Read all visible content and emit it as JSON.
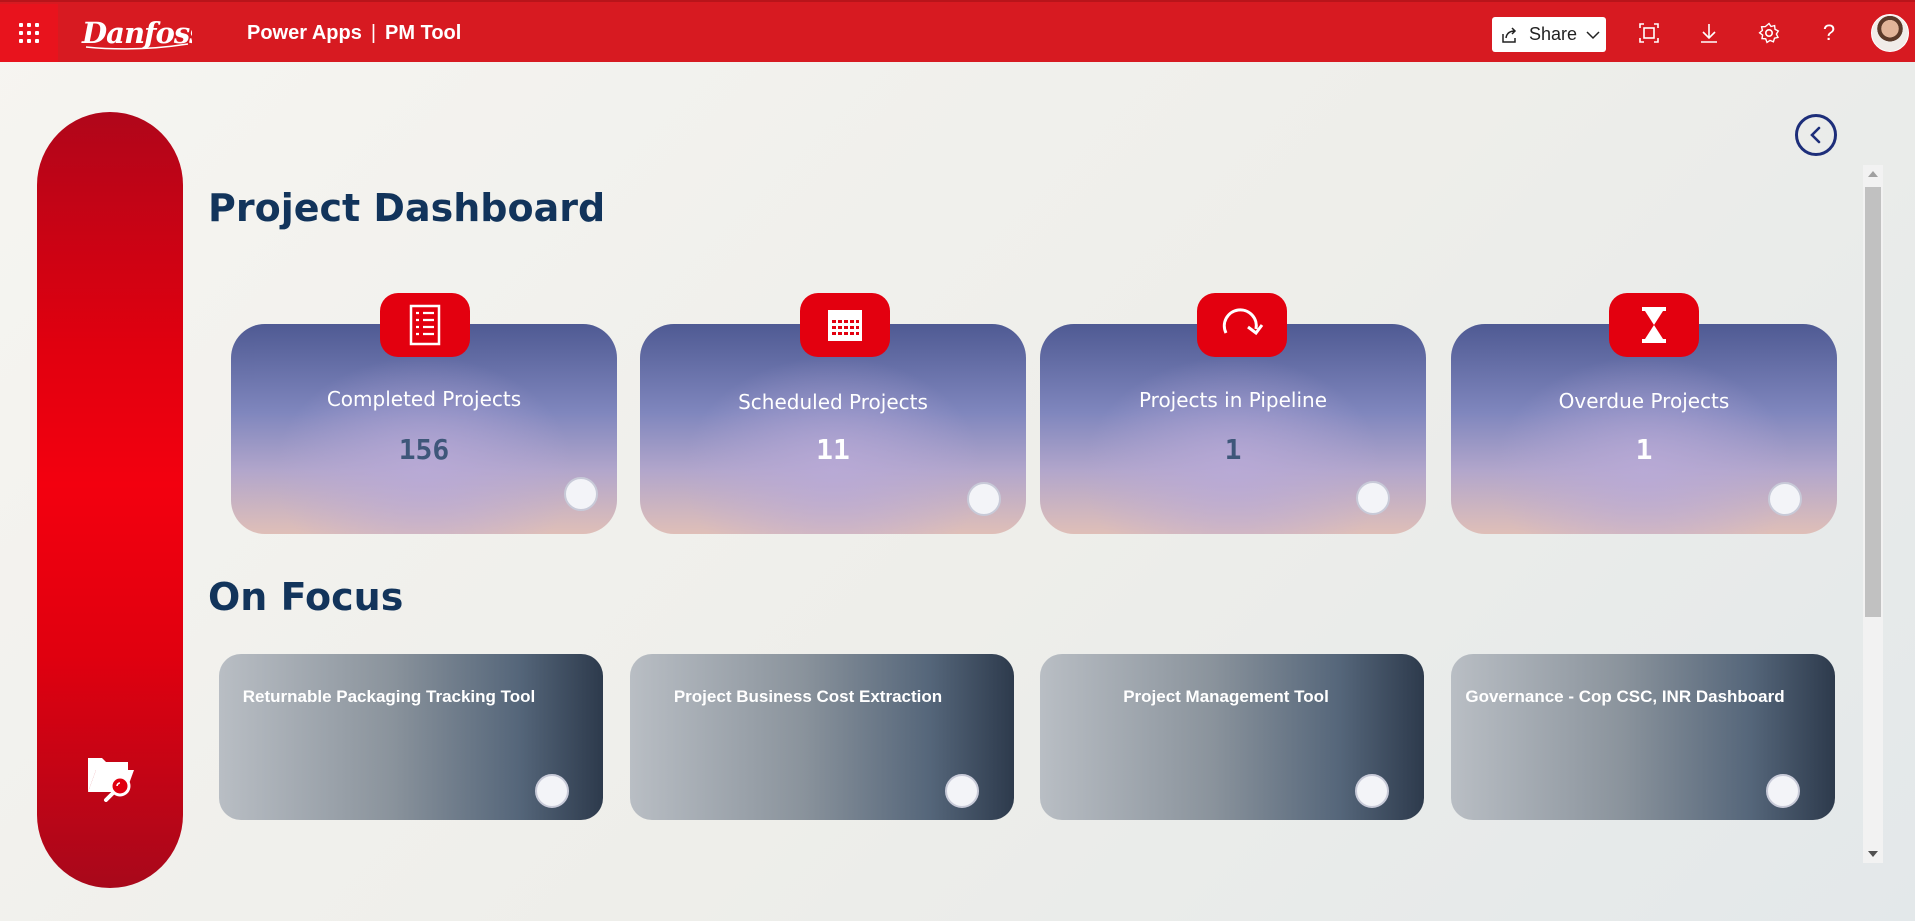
{
  "header": {
    "brand": "Danfoss",
    "app_name": "Power Apps",
    "separator": "|",
    "app_title": "PM Tool",
    "share_label": "Share",
    "help_glyph": "?",
    "icons": [
      "waffle-icon",
      "share-icon",
      "chevron-down-icon",
      "fit-screen-icon",
      "download-icon",
      "gear-icon",
      "help-icon",
      "avatar"
    ]
  },
  "sidebar": {
    "icon": "folder-search-icon"
  },
  "dashboard": {
    "title": "Project Dashboard",
    "cards": [
      {
        "label": "Completed Projects",
        "value": "156",
        "icon": "checklist-icon"
      },
      {
        "label": "Scheduled Projects",
        "value": "11",
        "icon": "calendar-icon"
      },
      {
        "label": "Projects in Pipeline",
        "value": "1",
        "icon": "refresh-icon"
      },
      {
        "label": "Overdue Projects",
        "value": "1",
        "icon": "hourglass-icon"
      }
    ]
  },
  "focus": {
    "title": "On Focus",
    "items": [
      {
        "label": "Returnable Packaging Tracking Tool"
      },
      {
        "label": "Project Business Cost Extraction"
      },
      {
        "label": "Project Management Tool"
      },
      {
        "label": "Governance - Cop CSC, INR Dashboard"
      }
    ]
  },
  "colors": {
    "brand_red": "#d71a21",
    "title_navy": "#12345b",
    "badge_red": "#e3000f"
  }
}
